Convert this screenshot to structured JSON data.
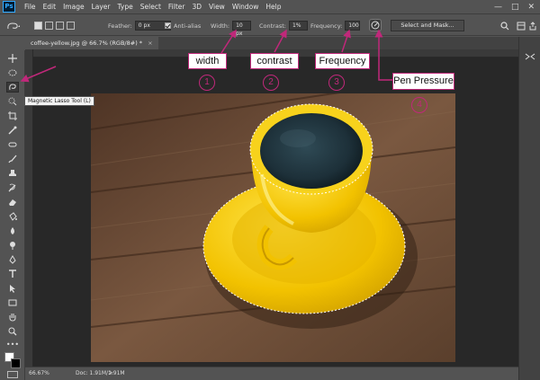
{
  "menubar": {
    "logo": "Ps",
    "items": [
      "File",
      "Edit",
      "Image",
      "Layer",
      "Type",
      "Select",
      "Filter",
      "3D",
      "View",
      "Window",
      "Help"
    ]
  },
  "options": {
    "feather_label": "Feather:",
    "feather_value": "0 px",
    "antialias_label": "Anti-alias",
    "width_label": "Width:",
    "width_value": "10 px",
    "contrast_label": "Contrast:",
    "contrast_value": "1%",
    "frequency_label": "Frequency:",
    "frequency_value": "100",
    "select_mask": "Select and Mask..."
  },
  "document": {
    "tab_title": "coffee-yellow.jpg @ 66.7% (RGB/8#) *",
    "close": "×"
  },
  "tooltip": "Magnetic Lasso Tool (L)",
  "status": {
    "zoom": "66.67%",
    "doc": "Doc: 1.91M/1.91M"
  },
  "annotations": {
    "width": {
      "label": "width",
      "num": "1"
    },
    "contrast": {
      "label": "contrast",
      "num": "2"
    },
    "frequency": {
      "label": "Frequency",
      "num": "3"
    },
    "pen": {
      "label": "Pen Pressure",
      "num": "4"
    }
  },
  "colors": {
    "accent": "#c0287a",
    "cup": "#f2c200",
    "wood": "#6b4a34"
  },
  "icons": {
    "search": "search-icon",
    "workspace": "workspace-icon",
    "share": "share-icon"
  }
}
